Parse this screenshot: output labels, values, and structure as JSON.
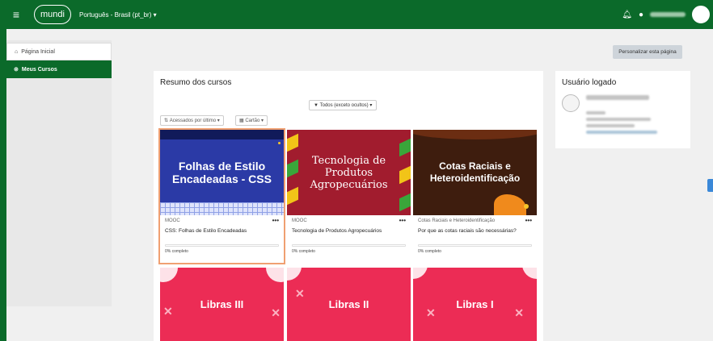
{
  "topbar": {
    "menu_icon": "hamburger-icon",
    "logo": "mundi",
    "language": "Português - Brasil (pt_br)",
    "language_caret": "▾",
    "bell_icon": "bell-icon",
    "chat_icon": "chat-icon"
  },
  "sidebar": {
    "items": [
      {
        "label": "Página Inicial",
        "icon": "home-icon",
        "glyph": "⌂"
      },
      {
        "label": "Meus Cursos",
        "icon": "dashboard-icon",
        "glyph": "⊚"
      }
    ]
  },
  "personalize_label": "Personalizar esta página",
  "courses": {
    "title": "Resumo dos cursos",
    "filter_label": "Todos (exceto ocultos)",
    "filter_glyph": "▼",
    "sort_label": "Acessados por último",
    "sort_glyph": "⇅",
    "view_label": "Cartão",
    "view_glyph": "▦",
    "caret": "▾",
    "more": "•••",
    "cards": [
      {
        "image_text": "Folhas de Estilo Encadeadas - CSS",
        "category": "MOOC",
        "name": "CSS: Folhas de Estilo Encadeadas",
        "progress": "0% completo"
      },
      {
        "image_text": "Tecnologia de Produtos Agropecuários",
        "category": "MOOC",
        "name": "Tecnologia de Produtos Agropecuários",
        "progress": "0% completo"
      },
      {
        "image_text": "Cotas Raciais e Heteroidentificação",
        "category": "Cotas Raciais e Heteroidentificação",
        "name": "Por que as cotas raciais são necessárias?",
        "progress": "0% completo"
      }
    ],
    "more_cards": [
      {
        "image_text": "Libras III"
      },
      {
        "image_text": "Libras II"
      },
      {
        "image_text": "Libras I"
      }
    ]
  },
  "user_block": {
    "title": "Usuário logado"
  },
  "colors": {
    "brand_green": "#0b6a2a",
    "highlight_outline": "#f0a072",
    "libras_pink": "#ec2c55"
  }
}
